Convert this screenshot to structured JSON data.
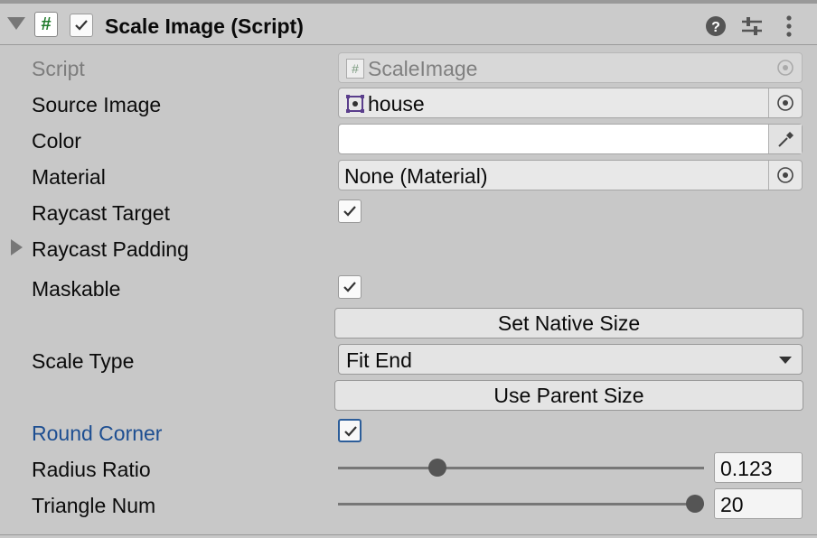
{
  "header": {
    "script_icon_glyph": "#",
    "title": "Scale Image (Script)",
    "icons": [
      "help-icon",
      "presets-icon",
      "kebab-menu-icon"
    ]
  },
  "fields": {
    "script": {
      "label": "Script",
      "value": "ScaleImage",
      "icon": "#"
    },
    "source_image": {
      "label": "Source Image",
      "value": "house"
    },
    "color": {
      "label": "Color",
      "value_hex": "#ffffff"
    },
    "material": {
      "label": "Material",
      "value": "None (Material)"
    },
    "raycast_target": {
      "label": "Raycast Target",
      "checked": true
    },
    "raycast_padding": {
      "label": "Raycast Padding"
    },
    "maskable": {
      "label": "Maskable",
      "checked": true
    },
    "set_native_size": {
      "label": "Set Native Size"
    },
    "scale_type": {
      "label": "Scale Type",
      "value": "Fit End"
    },
    "use_parent_size": {
      "label": "Use Parent Size"
    },
    "round_corner": {
      "label": "Round Corner",
      "checked": true
    },
    "radius_ratio": {
      "label": "Radius Ratio",
      "value": "0.123",
      "slider_fraction": 0.26
    },
    "triangle_num": {
      "label": "Triangle Num",
      "value": "20",
      "slider_fraction": 1.0
    }
  },
  "colors": {
    "accent_blue": "#1d4e91",
    "script_green": "#1f7a2a",
    "background": "#c8c8c8"
  }
}
